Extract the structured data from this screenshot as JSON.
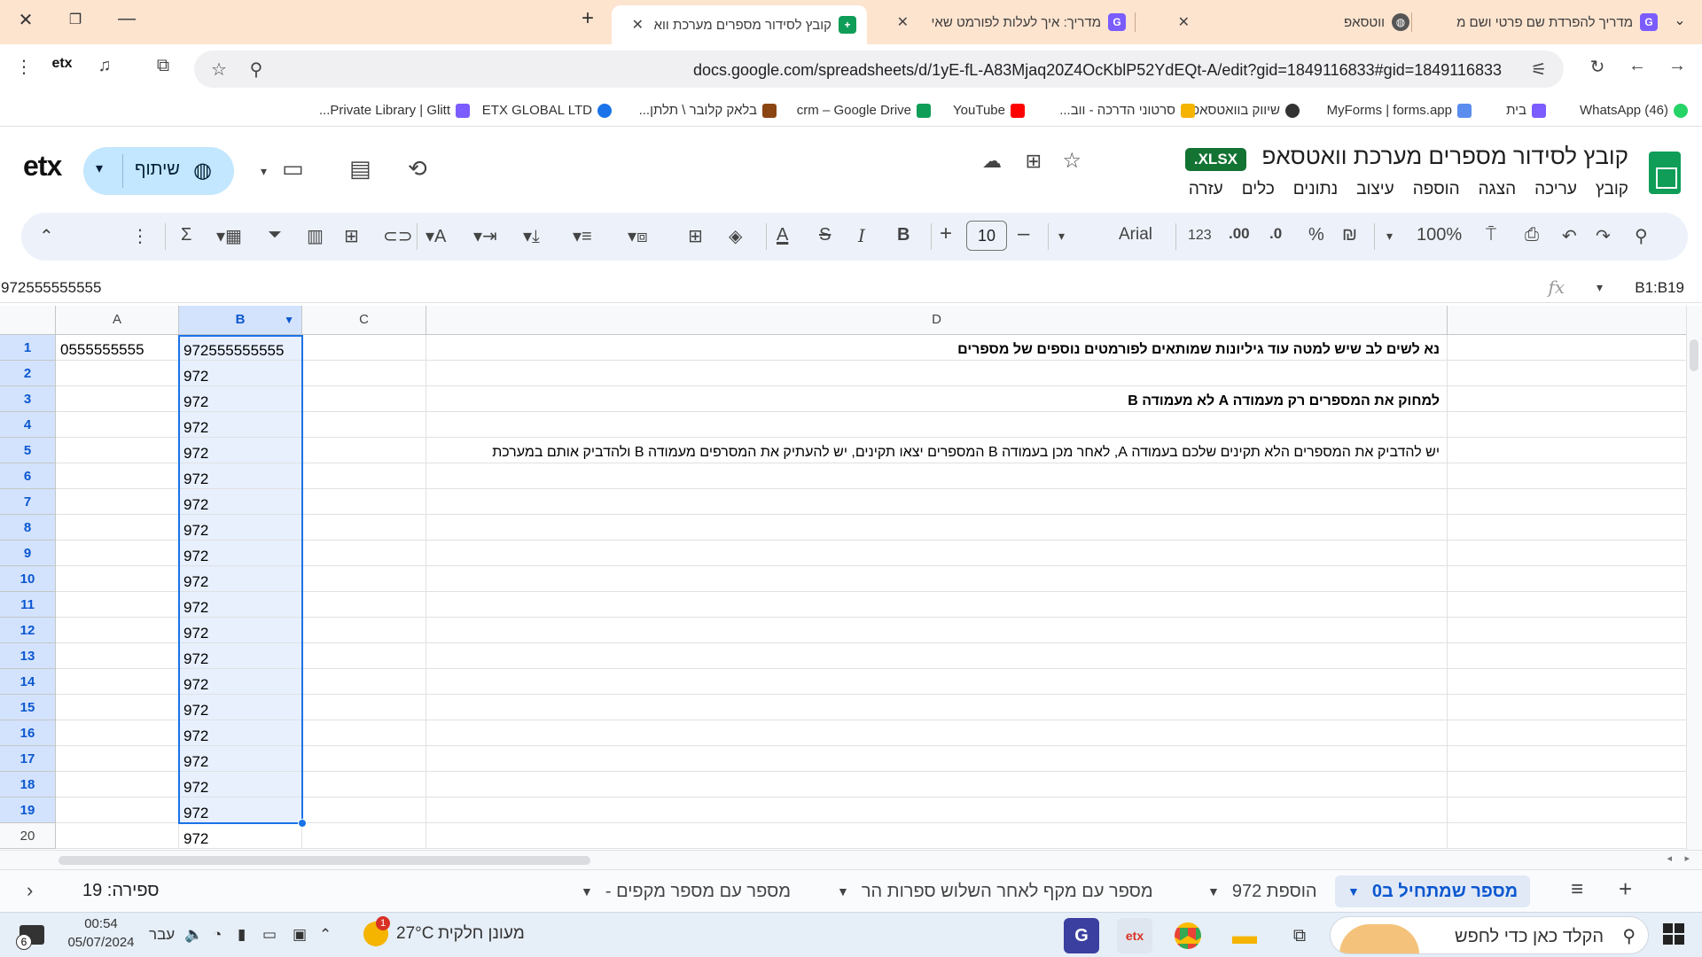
{
  "browser": {
    "tabs": [
      {
        "title": "מדריך להפרדת שם פרטי ושם מ",
        "active": false
      },
      {
        "title": "ווטסאפ",
        "active": false
      },
      {
        "title": "מדריך: איך לעלות לפורמט שאי",
        "active": false
      },
      {
        "title": "קובץ לסידור מספרים מערכת ווא",
        "active": true
      }
    ],
    "new_tab_label": "+",
    "url": "docs.google.com/spreadsheets/d/1yE-fL-A83Mjaq20Z4OcKblP52YdEQt-A/edit?gid=1849116833#gid=1849116833",
    "bookmarks": [
      {
        "label": "(46) WhatsApp",
        "color": "#25d366"
      },
      {
        "label": "בית",
        "color": "#7b5cff"
      },
      {
        "label": "MyForms | forms.app",
        "color": "#5b8def"
      },
      {
        "label": "שיווק בוואטסאפ",
        "color": "#333333"
      },
      {
        "label": "סרטוני הדרכה - ווב...",
        "color": "#f4b400"
      },
      {
        "label": "YouTube",
        "color": "#ff0000"
      },
      {
        "label": "crm – Google Drive",
        "color": "#0f9d58"
      },
      {
        "label": "בלאק קלובר \\ תלתן...",
        "color": "#8b4513"
      },
      {
        "label": "ETX GLOBAL LTD",
        "color": "#1a73e8"
      },
      {
        "label": "Private Library | Glitt...",
        "color": "#7b5cff"
      }
    ]
  },
  "doc": {
    "title": "קובץ לסידור מספרים מערכת וואטסאפ",
    "badge": ".XLSX",
    "menu": [
      "קובץ",
      "עריכה",
      "הצגה",
      "הוספה",
      "עיצוב",
      "נתונים",
      "כלים",
      "עזרה"
    ],
    "share_label": "שיתוף",
    "logo_text": "etx"
  },
  "format_toolbar": {
    "zoom": "100%",
    "currency": "₪",
    "percent": "%",
    "decrease_decimals": ".0",
    "increase_decimals": ".00",
    "number_format": "123",
    "font": "Arial",
    "font_size": "10"
  },
  "formula_bar": {
    "name_box": "B1:B19",
    "fx": "fx",
    "value": "972555555555"
  },
  "grid": {
    "columns": [
      "A",
      "B",
      "C",
      "D"
    ],
    "rows": [
      "1",
      "2",
      "3",
      "4",
      "5",
      "6",
      "7",
      "8",
      "9",
      "10",
      "11",
      "12",
      "13",
      "14",
      "15",
      "16",
      "17",
      "18",
      "19",
      "20"
    ],
    "col_a": [
      "0555555555"
    ],
    "col_b": [
      "972555555555",
      "972",
      "972",
      "972",
      "972",
      "972",
      "972",
      "972",
      "972",
      "972",
      "972",
      "972",
      "972",
      "972",
      "972",
      "972",
      "972",
      "972",
      "972",
      "972"
    ],
    "d1": "נא לשים לב שיש למטה עוד גיליונות שמותאים לפורמטים נוספים של מספרים",
    "d3": "למחוק את המספרים רק מעמודה A לא מעמודה B",
    "d5": "יש להדביק את המספרים הלא תקינים שלכם בעמודה A, לאחר מכן בעמודה B המספרים יצאו תקינים, יש להעתיק את המסרפים מעמודה B ולהדביק אותם במערכת"
  },
  "sheet_tabs": {
    "tabs": [
      {
        "label": "מספר שמתחיל ב0",
        "active": true
      },
      {
        "label": "הוספת 972",
        "active": false
      },
      {
        "label": "מספר עם מקף לאחר השלוש ספרות הר",
        "active": false
      },
      {
        "label": "מספר עם מספר מקפים -",
        "active": false
      }
    ],
    "count": "ספירה: 19"
  },
  "taskbar": {
    "search_placeholder": "הקלד כאן כדי לחפש",
    "weather_temp": "27°C",
    "weather_text": "מעונן חלקית",
    "language": "עבר",
    "time": "00:54",
    "date": "05/07/2024",
    "notifications": "6",
    "weather_badge": "1"
  }
}
